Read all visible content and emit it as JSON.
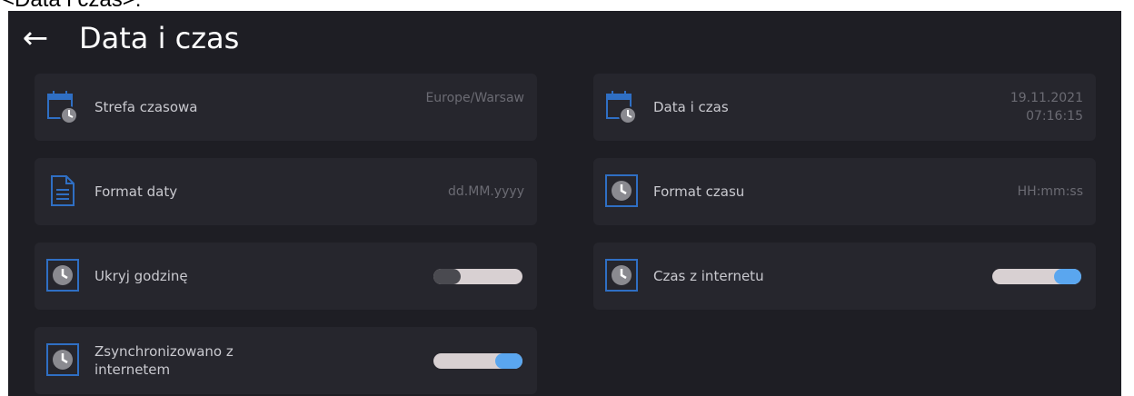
{
  "caption": "<Data i czas>:",
  "header": {
    "back_icon": "arrow-left-icon",
    "title": "Data i czas"
  },
  "settings": {
    "time_zone": {
      "label": "Strefa czasowa",
      "value": "Europe/Warsaw",
      "icon": "calendar-clock-icon"
    },
    "date_time": {
      "label": "Data i czas",
      "date": "19.11.2021",
      "time": "07:16:15",
      "icon": "calendar-clock-icon"
    },
    "date_format": {
      "label": "Format daty",
      "value": "dd.MM.yyyy",
      "icon": "document-icon"
    },
    "time_format": {
      "label": "Format czasu",
      "value": "HH:mm:ss",
      "icon": "clock-icon"
    },
    "hide_time": {
      "label": "Ukryj godzinę",
      "enabled": false,
      "icon": "clock-icon"
    },
    "internet_time": {
      "label": "Czas z internetu",
      "enabled": true,
      "icon": "clock-icon"
    },
    "synced": {
      "label": "Zsynchronizowano z internetem",
      "enabled": true,
      "icon": "clock-icon"
    }
  },
  "colors": {
    "background": "#1e1e24",
    "card": "#26262d",
    "accent": "#5aa6ef",
    "icon_blue": "#2f6fc4"
  }
}
